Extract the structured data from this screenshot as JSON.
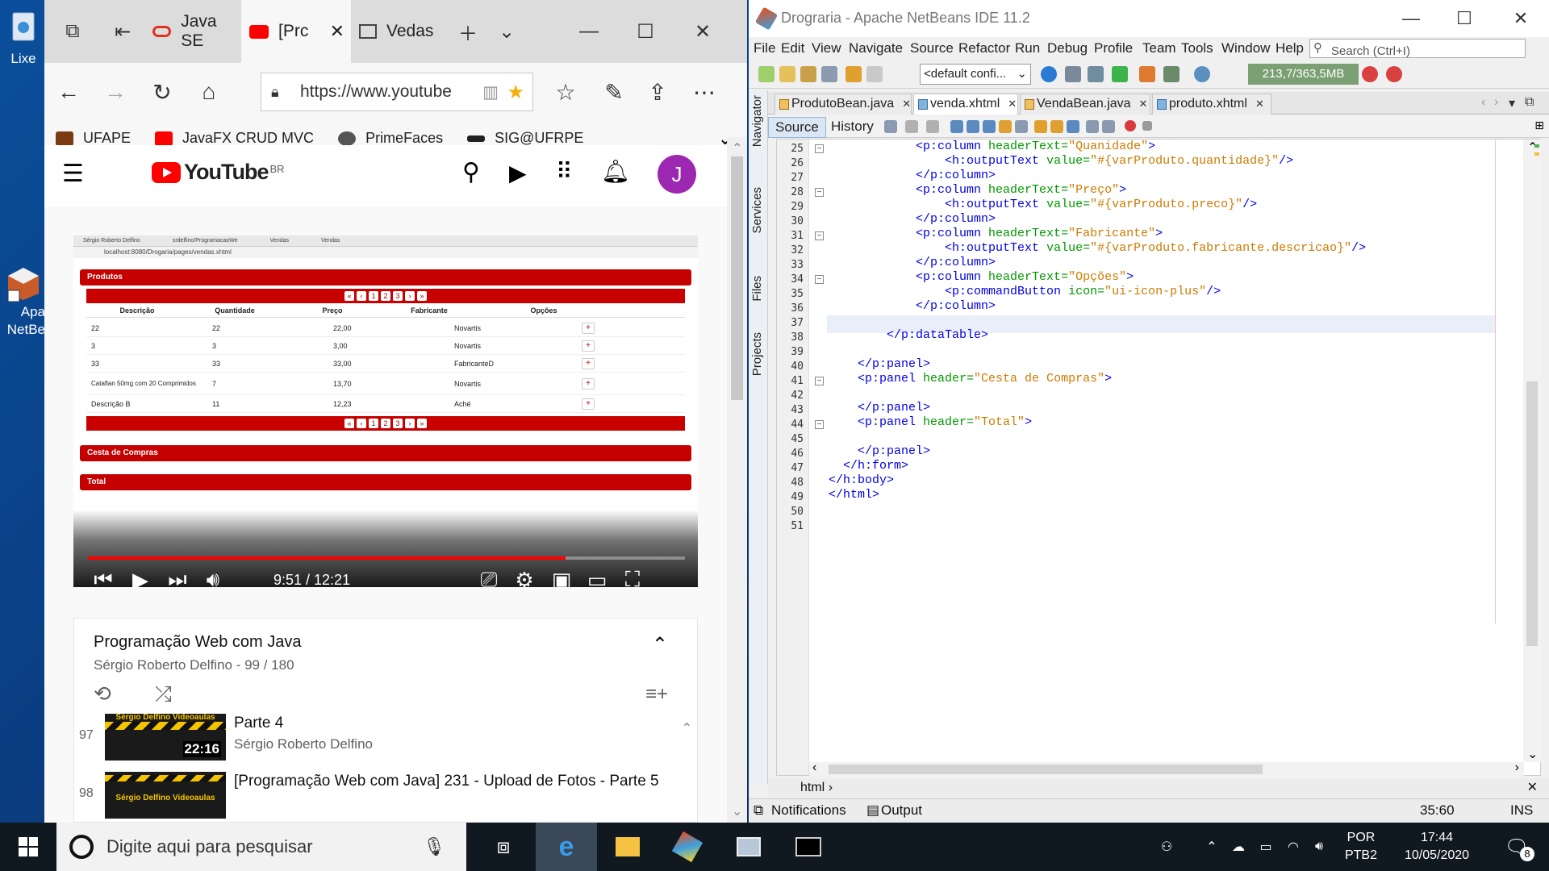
{
  "desktop": {
    "icons": [
      {
        "label": "Lixe",
        "icon": "recycle-bin-icon"
      },
      {
        "label": "Apa\nNetBe",
        "icon": "netbeans-shortcut-icon"
      }
    ]
  },
  "edge": {
    "tabs": [
      {
        "label": "",
        "icon": "tab-preview-icon"
      },
      {
        "label": "",
        "icon": "tabs-aside-icon"
      },
      {
        "label": "Java SE",
        "icon": "oracle-icon"
      },
      {
        "label": "[Prc",
        "icon": "youtube-icon",
        "active": true
      },
      {
        "label": "Vedas",
        "icon": "page-icon"
      }
    ],
    "address": "https://www.youtube",
    "favorites": [
      {
        "label": "UFAPE",
        "color": "#7a3b12"
      },
      {
        "label": "JavaFX CRUD MVC",
        "color": "#ff0000"
      },
      {
        "label": "PrimeFaces",
        "color": "#555555"
      },
      {
        "label": "SIG@UFRPE",
        "color": "#222222"
      }
    ]
  },
  "youtube": {
    "logo_text": "YouTube",
    "region": "BR",
    "avatar_letter": "J",
    "video": {
      "browser_tabs": [
        "Sérgio Roberto Delfino",
        "srdelfino/ProgramacaoWe",
        "Vendas",
        "Vendas"
      ],
      "address": "localhost:8080/Drogaria/pages/vendas.xhtml",
      "panel_products": "Produtos",
      "pager": [
        "«",
        "‹",
        "1",
        "2",
        "3",
        "›",
        "»"
      ],
      "columns": [
        "Descrição",
        "Quantidade",
        "Preço",
        "Fabricante",
        "Opções"
      ],
      "rows": [
        [
          "22",
          "22",
          "22,00",
          "Novartis"
        ],
        [
          "3",
          "3",
          "3,00",
          "Novartis"
        ],
        [
          "33",
          "33",
          "33,00",
          "FabricanteD"
        ],
        [
          "Cataflan 50mg com 20 Comprimidos",
          "7",
          "13,70",
          "Novartis"
        ],
        [
          "Descrição B",
          "11",
          "12,23",
          "Aché"
        ]
      ],
      "panel_cart": "Cesta de Compras",
      "panel_total": "Total",
      "time": "9:51 / 12:21",
      "progress_fraction": 0.8
    },
    "playlist": {
      "title": "Programação Web com Java",
      "subtitle": "Sérgio Roberto Delfino - 99 / 180",
      "items": [
        {
          "num": "97",
          "title": "Parte 4",
          "author": "Sérgio Roberto Delfino",
          "duration": "22:16",
          "brand": "Sérgio Delfino Videoaulas"
        },
        {
          "num": "98",
          "title": "[Programação Web com Java] 231 - Upload de Fotos - Parte 5",
          "author": "",
          "duration": "",
          "brand": "Sérgio Delfino Videoaulas"
        }
      ]
    }
  },
  "netbeans": {
    "title": "Drograria - Apache NetBeans IDE 11.2",
    "menu": [
      "File",
      "Edit",
      "View",
      "Navigate",
      "Source",
      "Refactor",
      "Run",
      "Debug",
      "Profile",
      "Team",
      "Tools",
      "Window",
      "Help"
    ],
    "search_placeholder": "Search (Ctrl+I)",
    "config": "<default confi...",
    "memory": "213,7/363,5MB",
    "side_panels": [
      "Navigator",
      "Services",
      "Files",
      "Projects"
    ],
    "file_tabs": [
      "ProdutoBean.java",
      "venda.xhtml",
      "VendaBean.java",
      "produto.xhtml"
    ],
    "active_tab": 1,
    "source_tab": "Source",
    "history_tab": "History",
    "line_numbers": [
      "25",
      "26",
      "27",
      "28",
      "29",
      "30",
      "31",
      "32",
      "33",
      "34",
      "35",
      "36",
      "37",
      "38",
      "39",
      "40",
      "41",
      "42",
      "43",
      "44",
      "45",
      "46",
      "47",
      "48",
      "49",
      "50",
      "51"
    ],
    "code_lines": [
      {
        "indent": "            ",
        "tag": "<p:column",
        "attr": " headerText=",
        "val": "\"Quanidade\"",
        "end": ">"
      },
      {
        "indent": "                ",
        "tag": "<h:outputText",
        "attr": " value=",
        "val": "\"#{varProduto.quantidade}\"",
        "end": "/>"
      },
      {
        "indent": "            ",
        "tag": "</p:column>",
        "attr": "",
        "val": "",
        "end": ""
      },
      {
        "indent": "            ",
        "tag": "<p:column",
        "attr": " headerText=",
        "val": "\"Preço\"",
        "end": ">"
      },
      {
        "indent": "                ",
        "tag": "<h:outputText",
        "attr": " value=",
        "val": "\"#{varProduto.preco}\"",
        "end": "/>"
      },
      {
        "indent": "            ",
        "tag": "</p:column>",
        "attr": "",
        "val": "",
        "end": ""
      },
      {
        "indent": "            ",
        "tag": "<p:column",
        "attr": " headerText=",
        "val": "\"Fabricante\"",
        "end": ">"
      },
      {
        "indent": "                ",
        "tag": "<h:outputText",
        "attr": " value=",
        "val": "\"#{varProduto.fabricante.descricao}\"",
        "end": "/>"
      },
      {
        "indent": "            ",
        "tag": "</p:column>",
        "attr": "",
        "val": "",
        "end": ""
      },
      {
        "indent": "            ",
        "tag": "<p:column",
        "attr": " headerText=",
        "val": "\"Opções\"",
        "end": ">"
      },
      {
        "indent": "                ",
        "tag": "<p:commandButton",
        "attr": " icon=",
        "val": "\"ui-icon-plus\"",
        "end": "/>"
      },
      {
        "indent": "            ",
        "tag": "</p:column>",
        "attr": "",
        "val": "",
        "end": ""
      },
      {
        "indent": "",
        "tag": "",
        "attr": "",
        "val": "",
        "end": ""
      },
      {
        "indent": "        ",
        "tag": "</p:dataTable>",
        "attr": "",
        "val": "",
        "end": ""
      },
      {
        "indent": "",
        "tag": "",
        "attr": "",
        "val": "",
        "end": ""
      },
      {
        "indent": "    ",
        "tag": "</p:panel>",
        "attr": "",
        "val": "",
        "end": ""
      },
      {
        "indent": "    ",
        "tag": "<p:panel",
        "attr": " header=",
        "val": "\"Cesta de Compras\"",
        "end": ">"
      },
      {
        "indent": "",
        "tag": "",
        "attr": "",
        "val": "",
        "end": ""
      },
      {
        "indent": "    ",
        "tag": "</p:panel>",
        "attr": "",
        "val": "",
        "end": ""
      },
      {
        "indent": "    ",
        "tag": "<p:panel",
        "attr": " header=",
        "val": "\"Total\"",
        "end": ">"
      },
      {
        "indent": "",
        "tag": "",
        "attr": "",
        "val": "",
        "end": ""
      },
      {
        "indent": "    ",
        "tag": "</p:panel>",
        "attr": "",
        "val": "",
        "end": ""
      },
      {
        "indent": "  ",
        "tag": "</h:form>",
        "attr": "",
        "val": "",
        "end": ""
      },
      {
        "indent": "",
        "tag": "</h:body>",
        "attr": "",
        "val": "",
        "end": ""
      },
      {
        "indent": "",
        "tag": "</html>",
        "attr": "",
        "val": "",
        "end": ""
      },
      {
        "indent": "",
        "tag": "",
        "attr": "",
        "val": "",
        "end": ""
      },
      {
        "indent": "",
        "tag": "",
        "attr": "",
        "val": "",
        "end": ""
      }
    ],
    "breadcrumb": "html",
    "status": {
      "notifications": "Notifications",
      "output": "Output",
      "position": "35:60",
      "mode": "INS"
    }
  },
  "taskbar": {
    "search_placeholder": "Digite aqui para pesquisar",
    "language_top": "POR",
    "language_bottom": "PTB2",
    "time": "17:44",
    "date": "10/05/2020",
    "notifications_count": "8"
  }
}
